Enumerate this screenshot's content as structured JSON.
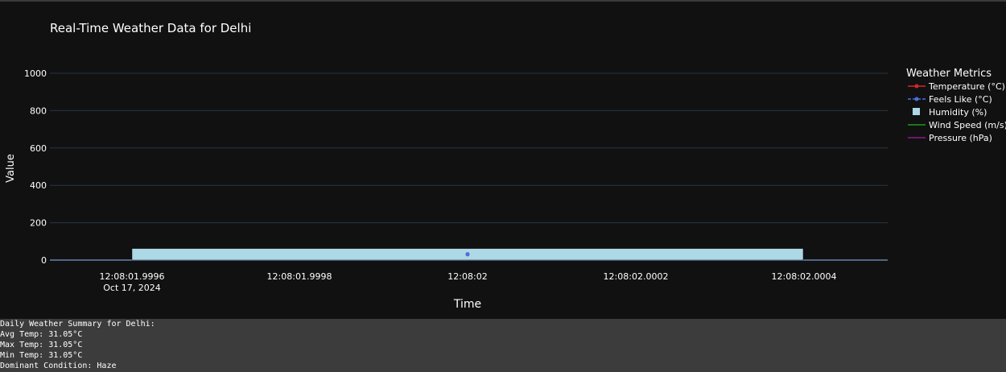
{
  "chart_data": {
    "type": "bar",
    "title": "Real-Time Weather Data for Delhi",
    "xlabel": "Time",
    "ylabel": "Value",
    "ylim": [
      0,
      1000
    ],
    "yticks": [
      "0",
      "200",
      "400",
      "600",
      "800",
      "1000"
    ],
    "yticks_values": [
      0,
      200,
      400,
      600,
      800,
      1000
    ],
    "xticks": [
      "12:08:01.9996",
      "12:08:01.9998",
      "12:08:02",
      "12:08:02.0002",
      "12:08:02.0004"
    ],
    "x_date_label": "Oct 17, 2024",
    "grid": true,
    "legend_position": "right",
    "legend": {
      "title": "Weather Metrics",
      "entries": [
        {
          "name": "Temperature (°C)",
          "kind": "line-marker",
          "color": "#d62728"
        },
        {
          "name": "Feels Like (°C)",
          "kind": "dash-marker",
          "color": "#4a6fe0"
        },
        {
          "name": "Humidity (%)",
          "kind": "square",
          "color": "#add8e6"
        },
        {
          "name": "Wind Speed (m/s)",
          "kind": "line",
          "color": "#1a9c1a"
        },
        {
          "name": "Pressure (hPa)",
          "kind": "line",
          "color": "#8b1a8b"
        }
      ]
    },
    "series": [
      {
        "name": "Humidity (%)",
        "type": "bar",
        "x": "12:08:02",
        "value": 62,
        "color": "#add8e6"
      },
      {
        "name": "Temperature (°C)",
        "type": "line",
        "x": "12:08:02",
        "value": 31.05,
        "color": "#d62728"
      },
      {
        "name": "Feels Like (°C)",
        "type": "line",
        "x": "12:08:02",
        "value": 31.05,
        "color": "#4a6fe0"
      }
    ]
  },
  "summary": {
    "lines": [
      "Daily Weather Summary for Delhi:",
      "Avg Temp: 31.05°C",
      "Max Temp: 31.05°C",
      "Min Temp: 31.05°C",
      "Dominant Condition: Haze"
    ]
  }
}
